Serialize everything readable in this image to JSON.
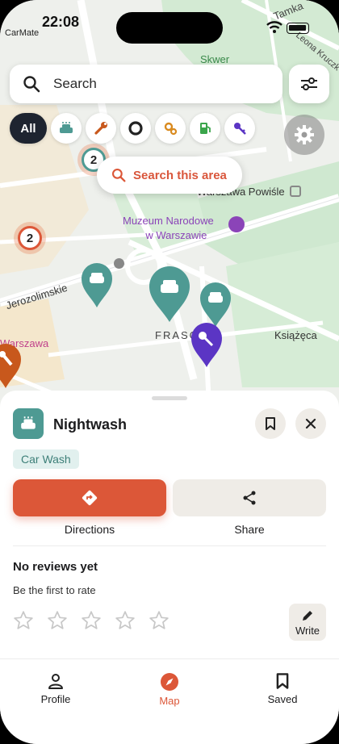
{
  "status_bar": {
    "time": "22:08",
    "carrier": "CarMate"
  },
  "search": {
    "placeholder": "Search"
  },
  "chips": {
    "all_label": "All",
    "items": [
      "car-wash-icon",
      "wrench-icon",
      "tire-icon",
      "gears-icon",
      "fuel-icon",
      "key-icon"
    ]
  },
  "map": {
    "search_area_label": "Search this area",
    "labels": {
      "tamka": "Tamka",
      "leona": "Leona Kruczk",
      "skwer": "Skwer",
      "station": "Warszawa Powiśle",
      "museum_line1": "Muzeum Narodowe",
      "museum_line2": "w Warszawie",
      "jerozolimskie": "Jerozolimskie",
      "frasc": "FRASC",
      "ksiazeca": "Książęca",
      "warszawa": "Warszawa"
    },
    "clusters": [
      {
        "count": "2"
      },
      {
        "count": "2"
      }
    ],
    "colors": {
      "teal": "#4e9a93",
      "purple": "#5b35c4",
      "orange": "#c8581c",
      "accent": "#dc5738"
    }
  },
  "place": {
    "name": "Nightwash",
    "category": "Car Wash",
    "directions_label": "Directions",
    "share_label": "Share",
    "reviews_title": "No reviews yet",
    "reviews_subtitle": "Be the first to rate",
    "rating": 0,
    "write_label": "Write"
  },
  "nav": {
    "profile": "Profile",
    "map": "Map",
    "saved": "Saved",
    "active": "Map"
  }
}
